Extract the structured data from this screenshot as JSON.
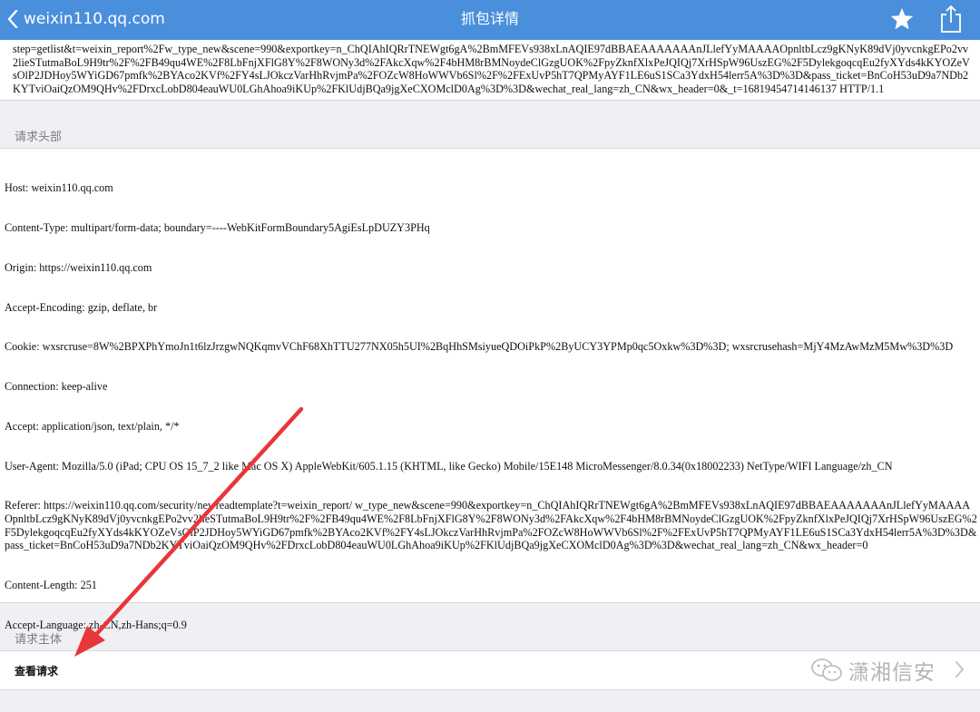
{
  "navbar": {
    "back_label": "weixin110.qq.com",
    "title": "抓包详情",
    "star_icon": "star-icon",
    "share_icon": "share-icon",
    "background_color": "#4a8fdc"
  },
  "request_line": {
    "text": "step=getlist&t=weixin_report%2Fw_type_new&scene=990&exportkey=n_ChQIAhIQRrTNEWgt6gA%2BmMFEVs938xLnAQIE97dBBAEAAAAAAAnJLlefYyMAAAAOpnltbLcz9gKNyK89dVj0yvcnkgEPo2vv2lieSTutmaBoL9H9tr%2F%2FB49qu4WE%2F8LbFnjXFlG8Y%2F8WONy3d%2FAkcXqw%2F4bHM8rBMNoydeClGzgUOK%2FpyZknfXlxPeJQIQj7XrHSpW96UszEG%2F5DylekgoqcqEu2fyXYds4kKYOZeVsOlP2JDHoy5WYiGD67pmfk%2BYAco2KVf%2FY4sLJOkczVarHhRvjmPa%2FOZcW8HoWWVb6Sl%2F%2FExUvP5hT7QPMyAYF1LE6uS1SCa3YdxH54lerr5A%3D%3D&pass_ticket=BnCoH53uD9a7NDb2KYTviOaiQzOM9QHv%2FDrxcLobD804eauWU0LGhAhoa9iKUp%2FKlUdjBQa9jgXeCXOMclD0Ag%3D%3D&wechat_real_lang=zh_CN&wx_header=0&_t=1681945471414613​7 HTTP/1.1"
  },
  "headers_section": {
    "label": "请求头部",
    "lines": [
      "Host: weixin110.qq.com",
      "Content-Type: multipart/form-data; boundary=----WebKitFormBoundary5AgiEsLpDUZY3PHq",
      "Origin: https://weixin110.qq.com",
      "Accept-Encoding: gzip, deflate, br",
      "Cookie: wxsrcruse=8W%2BPXPhYmoJn1t6lzJrzgwNQKqmvVChF68XhTTU277NX05h5UI%2BqHhSMsiyueQDOiPkP%2ByUCY3YPMp0qc5Oxkw%3D%3D; wxsrcrusehash=MjY4MzAwMzM5Mw%3D%3D",
      "Connection: keep-alive",
      "Accept: application/json, text/plain, */*",
      "User-Agent: Mozilla/5.0 (iPad; CPU OS 15_7_2 like Mac OS X) AppleWebKit/605.1.15 (KHTML, like Gecko) Mobile/15E148 MicroMessenger/8.0.34(0x18002233) NetType/WIFI Language/zh_CN",
      "Referer: https://weixin110.qq.com/security/newreadtemplate?t=weixin_report/ w_type_new&scene=990&exportkey=n_ChQIAhIQRrTNEWgt6gA%2BmMFEVs938xLnAQIE97dBBAEAAAAAAAnJLlefYyMAAAAOpnltbLcz9gKNyK89dVj0yvcnkgEPo2vv2lieSTutmaBoL9H9tr%2F%2FB49qu4WE%2F8LbFnjXFlG8Y%2F8WONy3d%2FAkcXqw%2F4bHM8rBMNoydeClGzgUOK%2FpyZknfXlxPeJQIQj7XrHSpW96UszEG%2F5DylekgoqcqEu2fyXYds4kKYOZeVsOlP2JDHoy5WYiGD67pmfk%2BYAco2KVf%2FY4sLJOkczVarHhRvjmPa%2FOZcW8HoWWVb6Sl%2F%2FExUvP5hT7QPMyAYF1LE6uS1SCa3YdxH54lerr5A%3D%3D&pass_ticket=BnCoH53uD9a7NDb2KYTviOaiQzOM9QHv%2FDrxcLobD804eauWU0LGhAhoa9iKUp%2FKlUdjBQa9jgXeCXOMclD0Ag%3D%3D&wechat_real_lang=zh_CN&wx_header=0",
      "Content-Length: 251",
      "Accept-Language: zh-CN,zh-Hans;q=0.9"
    ]
  },
  "body_section": {
    "label": "请求主体",
    "row_label": "查看请求",
    "chevron_icon": "chevron-right-icon"
  },
  "watermark": {
    "text": "潇湘信安",
    "icon": "wechat-icon"
  },
  "annotation": {
    "arrow_color": "#e8363a"
  }
}
